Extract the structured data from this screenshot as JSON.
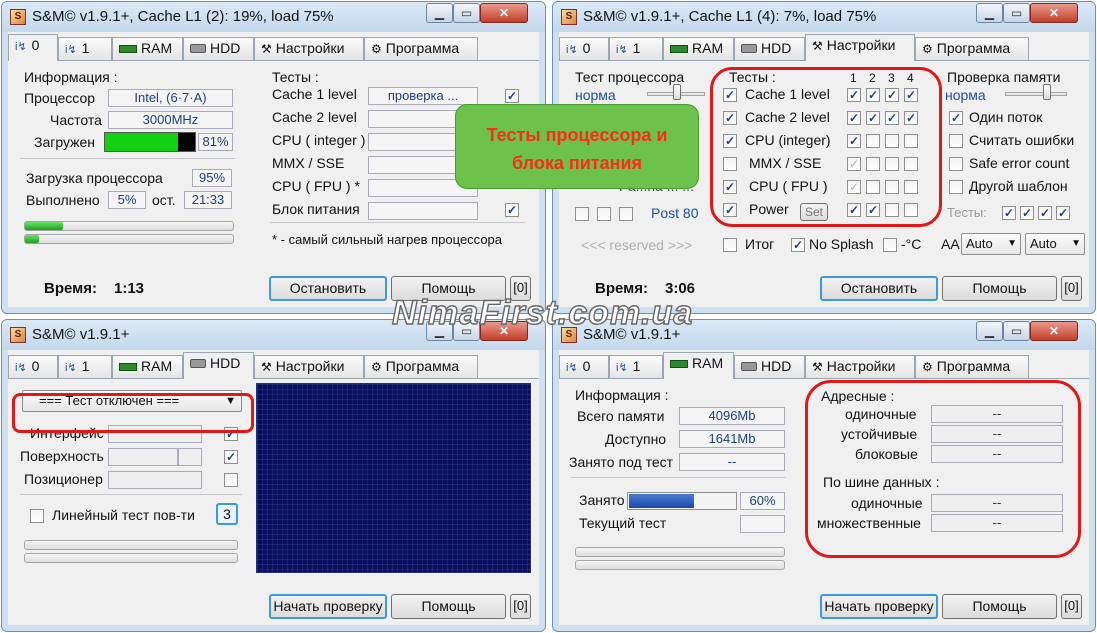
{
  "window_tl": {
    "title": "S&M© v1.9.1+, Cache L1 (2): 19%, load 75%",
    "tabs": [
      "0",
      "1",
      "RAM",
      "HDD",
      "Настройки",
      "Программа"
    ],
    "info_header": "Информация :",
    "processor_label": "Процессор",
    "processor_value": "Intel, (6·7·A)",
    "freq_label": "Частота",
    "freq_value": "3000MHz",
    "load_label": "Загружен",
    "load_value": "81%",
    "load_fraction": 0.81,
    "cpu_load_label": "Загрузка процессора",
    "cpu_load_value": "95%",
    "done_label": "Выполнено",
    "done_value": "5%",
    "remain_label": "ост.",
    "remain_value": "21:33",
    "tests_header": "Тесты :",
    "tests": [
      "Cache 1 level",
      "Cache 2 level",
      "CPU ( integer )",
      "MMX / SSE",
      "CPU ( FPU ) *",
      "Блок питания"
    ],
    "test_status": "проверка ...",
    "footnote": "* - самый сильный нагрев процессора",
    "time_label": "Время:",
    "time_value": "1:13",
    "stop_button": "Остановить",
    "help_button": "Помощь",
    "counter": "[0]"
  },
  "window_tr": {
    "title": "S&M© v1.9.1+, Cache L1 (4): 7%, load 75%",
    "tabs": [
      "0",
      "1",
      "RAM",
      "HDD",
      "Настройки",
      "Программа"
    ],
    "cpu_test_label": "Тест процессора",
    "cpu_test_mode": "норма",
    "tests_header": "Тесты :",
    "cols": [
      "1",
      "2",
      "3",
      "4"
    ],
    "tests": [
      "Cache 1 level",
      "Cache 2 level",
      "CPU (integer)",
      "MMX / SSE",
      "CPU ( FPU )",
      "Power"
    ],
    "set_button": "Set",
    "partial_label": "Ра...на ... ...",
    "post_label": "Post 80",
    "reserved": "<<< reserved >>>",
    "itog_label": "Итог",
    "nosplash_label": "No Splash",
    "celsius_label": "-°C",
    "memcheck_label": "Проверка памяти",
    "memcheck_mode": "норма",
    "opt_one_thread": "Один поток",
    "opt_count_errors": "Считать ошибки",
    "opt_safe_error": "Safe error count",
    "opt_other_pattern": "Другой шаблон",
    "tests_row_label": "Тесты:",
    "aa_label": "AA",
    "aa_select1": "Auto",
    "aa_select2": "Auto",
    "time_label": "Время:",
    "time_value": "3:06",
    "stop_button": "Остановить",
    "help_button": "Помощь",
    "counter": "[0]"
  },
  "window_bl": {
    "title": "S&M© v1.9.1+",
    "tabs": [
      "0",
      "1",
      "RAM",
      "HDD",
      "Настройки",
      "Программа"
    ],
    "hdd_select": "=== Тест отключен ===",
    "iface_label": "Интерфейс",
    "surface_label": "Поверхность",
    "positioner_label": "Позиционер",
    "linear_label": "Линейный тест пов-ти",
    "linear_count": "3",
    "start_button": "Начать проверку",
    "help_button": "Помощь",
    "counter": "[0]"
  },
  "window_br": {
    "title": "S&M© v1.9.1+",
    "tabs": [
      "0",
      "1",
      "RAM",
      "HDD",
      "Настройки",
      "Программа"
    ],
    "info_header": "Информация :",
    "total_label": "Всего памяти",
    "total_value": "4096Mb",
    "avail_label": "Доступно",
    "avail_value": "1641Mb",
    "busy_label": "Занято под тест",
    "busy_value": "--",
    "used_label": "Занято",
    "used_value": "60%",
    "used_fraction": 0.6,
    "current_label": "Текущий тест",
    "addr_header": "Адресные :",
    "addr_rows": [
      {
        "label": "одиночные",
        "value": "--"
      },
      {
        "label": "устойчивые",
        "value": "--"
      },
      {
        "label": "блоковые",
        "value": "--"
      }
    ],
    "bus_header": "По шине данных :",
    "bus_rows": [
      {
        "label": "одиночные",
        "value": "--"
      },
      {
        "label": "множественные",
        "value": "--"
      }
    ],
    "start_button": "Начать проверку",
    "help_button": "Помощь",
    "counter": "[0]"
  },
  "callout": "Тесты процессора и блока питания",
  "watermark": "NimaFirst.com.ua",
  "colors": {
    "accent_red": "#e01818",
    "callout_green": "#6cc24a",
    "callout_text": "#ff2a1a",
    "hdd_panel": "#0a0f5c"
  }
}
